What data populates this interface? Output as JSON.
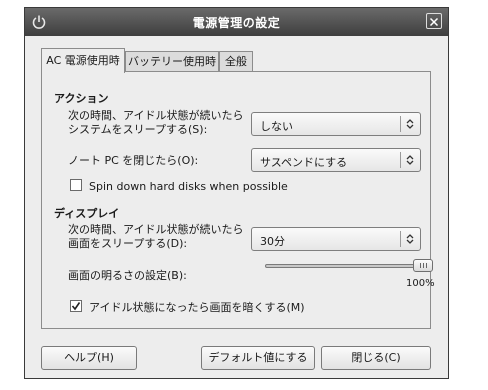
{
  "window": {
    "title": "電源管理の設定",
    "app_icon": "power-manager-icon",
    "close_icon": "close-icon"
  },
  "tabs": [
    {
      "label": "AC 電源使用時",
      "active": true
    },
    {
      "label": "バッテリー使用時",
      "active": false
    },
    {
      "label": "全般",
      "active": false
    }
  ],
  "action": {
    "heading": "アクション",
    "idle_label_line1": "次の時間、アイドル状態が続いたら",
    "idle_label_line2": "システムをスリープする(S):",
    "idle_value": "しない",
    "lid_label": "ノート PC を閉じたら(O):",
    "lid_value": "サスペンドにする",
    "spin_down_label": "Spin down hard disks when possible",
    "spin_down_checked": false
  },
  "display": {
    "heading": "ディスプレイ",
    "sleep_label_line1": "次の時間、アイドル状態が続いたら",
    "sleep_label_line2": "画面をスリープする(D):",
    "sleep_value": "30分",
    "brightness_label": "画面の明るさの設定(B):",
    "brightness_fraction": 1.0,
    "brightness_text": "100%",
    "dim_label": "アイドル状態になったら画面を暗くする(M)",
    "dim_checked": true
  },
  "buttons": {
    "help": "ヘルプ(H)",
    "defaults": "デフォルト値にする",
    "close": "閉じる(C)"
  }
}
